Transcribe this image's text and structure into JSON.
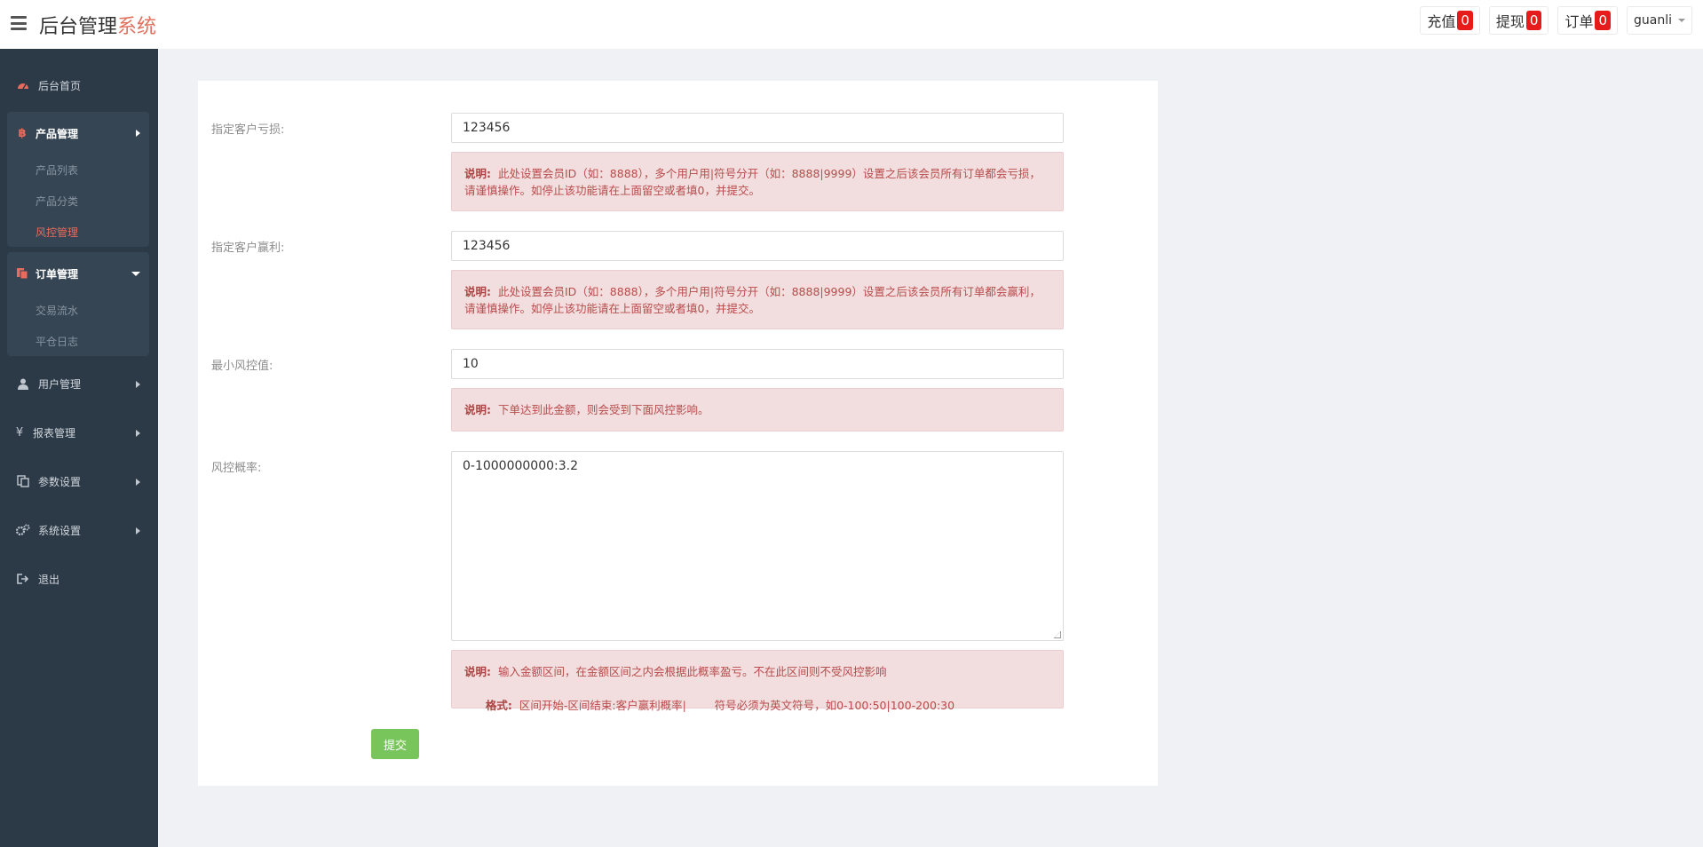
{
  "brand": {
    "main": "后台管理",
    "accent": "系统"
  },
  "topbar": {
    "recharge": {
      "label": "充值",
      "count": "0"
    },
    "withdraw": {
      "label": "提现",
      "count": "0"
    },
    "orders": {
      "label": "订单",
      "count": "0"
    },
    "user": "guanli"
  },
  "sidebar": {
    "home": "后台首页",
    "product": {
      "label": "产品管理",
      "items": [
        "产品列表",
        "产品分类",
        "风控管理"
      ]
    },
    "order": {
      "label": "订单管理",
      "items": [
        "交易流水",
        "平仓日志"
      ]
    },
    "users": "用户管理",
    "reports": "报表管理",
    "params": "参数设置",
    "system": "系统设置",
    "logout": "退出"
  },
  "form": {
    "loss": {
      "label": "指定客户亏损:",
      "value": "123456",
      "note_title": "说明:",
      "note": "此处设置会员ID（如：8888），多个用户用|符号分开（如：8888|9999）设置之后该会员所有订单都会亏损，请谨慎操作。如停止该功能请在上面留空或者填0，并提交。"
    },
    "profit": {
      "label": "指定客户赢利:",
      "value": "123456",
      "note_title": "说明:",
      "note": "此处设置会员ID（如：8888），多个用户用|符号分开（如：8888|9999）设置之后该会员所有订单都会赢利，请谨慎操作。如停止该功能请在上面留空或者填0，并提交。"
    },
    "min_risk": {
      "label": "最小风控值:",
      "value": "10",
      "note_title": "说明:",
      "note": "下单达到此金额，则会受到下面风控影响。"
    },
    "risk_rate": {
      "label": "风控概率:",
      "value": "0-1000000000:3.2",
      "note_title": "说明:",
      "note": "输入金额区间，在金额区间之内会根据此概率盈亏。不在此区间则不受风控影响",
      "format_title": "格式:",
      "format": "区间开始-区间结束:客户赢利概率|        符号必须为英文符号，如0-100:50|100-200:30"
    },
    "submit": "提交"
  }
}
